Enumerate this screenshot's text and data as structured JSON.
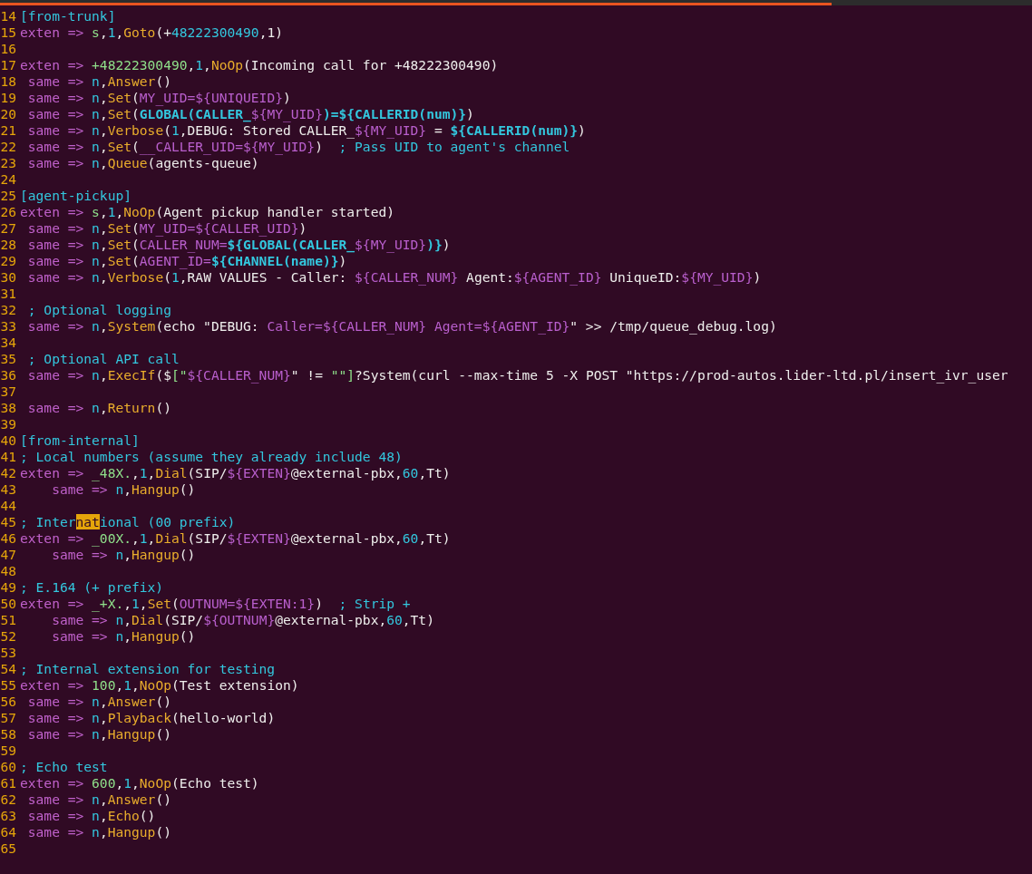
{
  "editor": {
    "lines": [
      {
        "number": "14",
        "segments": [
          {
            "kind": "section",
            "text": "[from-trunk]"
          }
        ]
      },
      {
        "number": "15",
        "segments": [
          {
            "kind": "keyword",
            "text": "exten => "
          },
          {
            "kind": "ext",
            "text": "s"
          },
          {
            "kind": "plain",
            "text": ","
          },
          {
            "kind": "number",
            "text": "1"
          },
          {
            "kind": "plain",
            "text": ","
          },
          {
            "kind": "function",
            "text": "Goto"
          },
          {
            "kind": "plain",
            "text": "(+"
          },
          {
            "kind": "number",
            "text": "48222300490"
          },
          {
            "kind": "plain",
            "text": ",1)"
          }
        ]
      },
      {
        "number": "16"
      },
      {
        "number": "17",
        "segments": [
          {
            "kind": "keyword",
            "text": "exten => "
          },
          {
            "kind": "ext",
            "text": "+48222300490"
          },
          {
            "kind": "plain",
            "text": ","
          },
          {
            "kind": "number",
            "text": "1"
          },
          {
            "kind": "plain",
            "text": ","
          },
          {
            "kind": "function",
            "text": "NoOp"
          },
          {
            "kind": "plain",
            "text": "(Incoming call for +48222300490)"
          }
        ]
      },
      {
        "number": "18",
        "segments": [
          {
            "kind": "keyword",
            "text": " same => "
          },
          {
            "kind": "number",
            "text": "n"
          },
          {
            "kind": "plain",
            "text": ","
          },
          {
            "kind": "function",
            "text": "Answer"
          },
          {
            "kind": "plain",
            "text": "()"
          }
        ]
      },
      {
        "number": "19",
        "segments": [
          {
            "kind": "keyword",
            "text": " same => "
          },
          {
            "kind": "number",
            "text": "n"
          },
          {
            "kind": "plain",
            "text": ","
          },
          {
            "kind": "function",
            "text": "Set"
          },
          {
            "kind": "plain",
            "text": "("
          },
          {
            "kind": "variable",
            "text": "MY_UID=${UNIQUEID}"
          },
          {
            "kind": "plain",
            "text": ")"
          }
        ]
      },
      {
        "number": "20",
        "segments": [
          {
            "kind": "keyword",
            "text": " same => "
          },
          {
            "kind": "number",
            "text": "n"
          },
          {
            "kind": "plain",
            "text": ","
          },
          {
            "kind": "function",
            "text": "Set"
          },
          {
            "kind": "plain",
            "text": "("
          },
          {
            "kind": "bold-variable",
            "text": "GLOBAL(CALLER_"
          },
          {
            "kind": "variable",
            "text": "${MY_UID}"
          },
          {
            "kind": "bold-variable",
            "text": ")=${CALLERID(num)}"
          },
          {
            "kind": "plain",
            "text": ")"
          }
        ]
      },
      {
        "number": "21",
        "segments": [
          {
            "kind": "keyword",
            "text": " same => "
          },
          {
            "kind": "number",
            "text": "n"
          },
          {
            "kind": "plain",
            "text": ","
          },
          {
            "kind": "function",
            "text": "Verbose"
          },
          {
            "kind": "plain",
            "text": "("
          },
          {
            "kind": "number",
            "text": "1"
          },
          {
            "kind": "plain",
            "text": ",DEBUG: Stored CALLER_"
          },
          {
            "kind": "variable",
            "text": "${MY_UID}"
          },
          {
            "kind": "plain",
            "text": " = "
          },
          {
            "kind": "bold-variable",
            "text": "${CALLERID(num)}"
          },
          {
            "kind": "plain",
            "text": ")"
          }
        ]
      },
      {
        "number": "22",
        "segments": [
          {
            "kind": "keyword",
            "text": " same => "
          },
          {
            "kind": "number",
            "text": "n"
          },
          {
            "kind": "plain",
            "text": ","
          },
          {
            "kind": "function",
            "text": "Set"
          },
          {
            "kind": "plain",
            "text": "("
          },
          {
            "kind": "variable",
            "text": "__CALLER_UID=${MY_UID}"
          },
          {
            "kind": "plain",
            "text": ")"
          },
          {
            "kind": "comment",
            "text": "  ; Pass UID to agent's channel"
          }
        ]
      },
      {
        "number": "23",
        "segments": [
          {
            "kind": "keyword",
            "text": " same => "
          },
          {
            "kind": "number",
            "text": "n"
          },
          {
            "kind": "plain",
            "text": ","
          },
          {
            "kind": "function",
            "text": "Queue"
          },
          {
            "kind": "plain",
            "text": "(agents-queue)"
          }
        ]
      },
      {
        "number": "24"
      },
      {
        "number": "25",
        "segments": [
          {
            "kind": "section",
            "text": "[agent-pickup]"
          }
        ]
      },
      {
        "number": "26",
        "segments": [
          {
            "kind": "keyword",
            "text": "exten => "
          },
          {
            "kind": "ext",
            "text": "s"
          },
          {
            "kind": "plain",
            "text": ","
          },
          {
            "kind": "number",
            "text": "1"
          },
          {
            "kind": "plain",
            "text": ","
          },
          {
            "kind": "function",
            "text": "NoOp"
          },
          {
            "kind": "plain",
            "text": "(Agent pickup handler started)"
          }
        ]
      },
      {
        "number": "27",
        "segments": [
          {
            "kind": "keyword",
            "text": " same => "
          },
          {
            "kind": "number",
            "text": "n"
          },
          {
            "kind": "plain",
            "text": ","
          },
          {
            "kind": "function",
            "text": "Set"
          },
          {
            "kind": "plain",
            "text": "("
          },
          {
            "kind": "variable",
            "text": "MY_UID=${CALLER_UID}"
          },
          {
            "kind": "plain",
            "text": ")"
          }
        ]
      },
      {
        "number": "28",
        "segments": [
          {
            "kind": "keyword",
            "text": " same => "
          },
          {
            "kind": "number",
            "text": "n"
          },
          {
            "kind": "plain",
            "text": ","
          },
          {
            "kind": "function",
            "text": "Set"
          },
          {
            "kind": "plain",
            "text": "("
          },
          {
            "kind": "variable",
            "text": "CALLER_NUM="
          },
          {
            "kind": "bold-variable",
            "text": "${GLOBAL(CALLER_"
          },
          {
            "kind": "variable",
            "text": "${MY_UID}"
          },
          {
            "kind": "bold-variable",
            "text": ")}"
          },
          {
            "kind": "plain",
            "text": ")"
          }
        ]
      },
      {
        "number": "29",
        "segments": [
          {
            "kind": "keyword",
            "text": " same => "
          },
          {
            "kind": "number",
            "text": "n"
          },
          {
            "kind": "plain",
            "text": ","
          },
          {
            "kind": "function",
            "text": "Set"
          },
          {
            "kind": "plain",
            "text": "("
          },
          {
            "kind": "variable",
            "text": "AGENT_ID="
          },
          {
            "kind": "bold-variable",
            "text": "${CHANNEL(name)}"
          },
          {
            "kind": "plain",
            "text": ")"
          }
        ]
      },
      {
        "number": "30",
        "segments": [
          {
            "kind": "keyword",
            "text": " same => "
          },
          {
            "kind": "number",
            "text": "n"
          },
          {
            "kind": "plain",
            "text": ","
          },
          {
            "kind": "function",
            "text": "Verbose"
          },
          {
            "kind": "plain",
            "text": "("
          },
          {
            "kind": "number",
            "text": "1"
          },
          {
            "kind": "plain",
            "text": ",RAW VALUES - Caller: "
          },
          {
            "kind": "variable",
            "text": "${CALLER_NUM}"
          },
          {
            "kind": "plain",
            "text": " Agent:"
          },
          {
            "kind": "variable",
            "text": "${AGENT_ID}"
          },
          {
            "kind": "plain",
            "text": " UniqueID:"
          },
          {
            "kind": "variable",
            "text": "${MY_UID}"
          },
          {
            "kind": "plain",
            "text": ")"
          }
        ]
      },
      {
        "number": "31"
      },
      {
        "number": "32",
        "segments": [
          {
            "kind": "comment",
            "text": " ; Optional logging"
          }
        ]
      },
      {
        "number": "33",
        "segments": [
          {
            "kind": "keyword",
            "text": " same => "
          },
          {
            "kind": "number",
            "text": "n"
          },
          {
            "kind": "plain",
            "text": ","
          },
          {
            "kind": "function",
            "text": "System"
          },
          {
            "kind": "plain",
            "text": "(echo \"DEBUG: "
          },
          {
            "kind": "variable",
            "text": "Caller=${CALLER_NUM} Agent=${AGENT_ID}"
          },
          {
            "kind": "plain",
            "text": "\" >> /tmp/queue_debug.log)"
          }
        ]
      },
      {
        "number": "34"
      },
      {
        "number": "35",
        "segments": [
          {
            "kind": "comment",
            "text": " ; Optional API call"
          }
        ]
      },
      {
        "number": "36",
        "segments": [
          {
            "kind": "keyword",
            "text": " same => "
          },
          {
            "kind": "number",
            "text": "n"
          },
          {
            "kind": "plain",
            "text": ","
          },
          {
            "kind": "function",
            "text": "ExecIf"
          },
          {
            "kind": "plain",
            "text": "($"
          },
          {
            "kind": "ext",
            "text": "[\""
          },
          {
            "kind": "variable",
            "text": "${CALLER_NUM}"
          },
          {
            "kind": "plain",
            "text": "\" != "
          },
          {
            "kind": "ext",
            "text": "\"\"]"
          },
          {
            "kind": "plain",
            "text": "?System(curl --max-time 5 -X POST \"https://prod-autos.lider-ltd.pl/insert_ivr_user"
          }
        ]
      },
      {
        "number": "37"
      },
      {
        "number": "38",
        "segments": [
          {
            "kind": "keyword",
            "text": " same => "
          },
          {
            "kind": "number",
            "text": "n"
          },
          {
            "kind": "plain",
            "text": ","
          },
          {
            "kind": "function",
            "text": "Return"
          },
          {
            "kind": "plain",
            "text": "()"
          }
        ]
      },
      {
        "number": "39"
      },
      {
        "number": "40",
        "segments": [
          {
            "kind": "section",
            "text": "[from-internal]"
          }
        ]
      },
      {
        "number": "41",
        "segments": [
          {
            "kind": "comment",
            "text": "; Local numbers (assume they already include 48)"
          }
        ]
      },
      {
        "number": "42",
        "segments": [
          {
            "kind": "keyword",
            "text": "exten => "
          },
          {
            "kind": "ext",
            "text": "_48X."
          },
          {
            "kind": "plain",
            "text": ","
          },
          {
            "kind": "number",
            "text": "1"
          },
          {
            "kind": "plain",
            "text": ","
          },
          {
            "kind": "function",
            "text": "Dial"
          },
          {
            "kind": "plain",
            "text": "(SIP/"
          },
          {
            "kind": "variable",
            "text": "${EXTEN}"
          },
          {
            "kind": "plain",
            "text": "@external-pbx,"
          },
          {
            "kind": "number",
            "text": "60"
          },
          {
            "kind": "plain",
            "text": ",Tt)"
          }
        ]
      },
      {
        "number": "43",
        "segments": [
          {
            "kind": "keyword",
            "text": "    same => "
          },
          {
            "kind": "number",
            "text": "n"
          },
          {
            "kind": "plain",
            "text": ","
          },
          {
            "kind": "function",
            "text": "Hangup"
          },
          {
            "kind": "plain",
            "text": "()"
          }
        ]
      },
      {
        "number": "44"
      },
      {
        "number": "45",
        "segments": [
          {
            "kind": "comment",
            "text": "; Inter"
          },
          {
            "kind": "search-match",
            "text": "nat"
          },
          {
            "kind": "comment",
            "text": "ional (00 prefix)"
          }
        ]
      },
      {
        "number": "46",
        "segments": [
          {
            "kind": "keyword",
            "text": "exten => "
          },
          {
            "kind": "ext",
            "text": "_00X."
          },
          {
            "kind": "plain",
            "text": ","
          },
          {
            "kind": "number",
            "text": "1"
          },
          {
            "kind": "plain",
            "text": ","
          },
          {
            "kind": "function",
            "text": "Dial"
          },
          {
            "kind": "plain",
            "text": "(SIP/"
          },
          {
            "kind": "variable",
            "text": "${EXTEN}"
          },
          {
            "kind": "plain",
            "text": "@external-pbx,"
          },
          {
            "kind": "number",
            "text": "60"
          },
          {
            "kind": "plain",
            "text": ",Tt)"
          }
        ]
      },
      {
        "number": "47",
        "segments": [
          {
            "kind": "keyword",
            "text": "    same => "
          },
          {
            "kind": "number",
            "text": "n"
          },
          {
            "kind": "plain",
            "text": ","
          },
          {
            "kind": "function",
            "text": "Hangup"
          },
          {
            "kind": "plain",
            "text": "()"
          }
        ]
      },
      {
        "number": "48"
      },
      {
        "number": "49",
        "segments": [
          {
            "kind": "comment",
            "text": "; E.164 (+ prefix)"
          }
        ]
      },
      {
        "number": "50",
        "segments": [
          {
            "kind": "keyword",
            "text": "exten => "
          },
          {
            "kind": "ext",
            "text": "_+X."
          },
          {
            "kind": "plain",
            "text": ","
          },
          {
            "kind": "number",
            "text": "1"
          },
          {
            "kind": "plain",
            "text": ","
          },
          {
            "kind": "function",
            "text": "Set"
          },
          {
            "kind": "plain",
            "text": "("
          },
          {
            "kind": "variable",
            "text": "OUTNUM=${EXTEN:1}"
          },
          {
            "kind": "plain",
            "text": ")"
          },
          {
            "kind": "comment",
            "text": "  ; Strip +"
          }
        ]
      },
      {
        "number": "51",
        "segments": [
          {
            "kind": "keyword",
            "text": "    same => "
          },
          {
            "kind": "number",
            "text": "n"
          },
          {
            "kind": "plain",
            "text": ","
          },
          {
            "kind": "function",
            "text": "Dial"
          },
          {
            "kind": "plain",
            "text": "(SIP/"
          },
          {
            "kind": "variable",
            "text": "${OUTNUM}"
          },
          {
            "kind": "plain",
            "text": "@external-pbx,"
          },
          {
            "kind": "number",
            "text": "60"
          },
          {
            "kind": "plain",
            "text": ",Tt)"
          }
        ]
      },
      {
        "number": "52",
        "segments": [
          {
            "kind": "keyword",
            "text": "    same => "
          },
          {
            "kind": "number",
            "text": "n"
          },
          {
            "kind": "plain",
            "text": ","
          },
          {
            "kind": "function",
            "text": "Hangup"
          },
          {
            "kind": "plain",
            "text": "()"
          }
        ]
      },
      {
        "number": "53"
      },
      {
        "number": "54",
        "segments": [
          {
            "kind": "comment",
            "text": "; Internal extension for testing"
          }
        ]
      },
      {
        "number": "55",
        "segments": [
          {
            "kind": "keyword",
            "text": "exten => "
          },
          {
            "kind": "ext",
            "text": "100"
          },
          {
            "kind": "plain",
            "text": ","
          },
          {
            "kind": "number",
            "text": "1"
          },
          {
            "kind": "plain",
            "text": ","
          },
          {
            "kind": "function",
            "text": "NoOp"
          },
          {
            "kind": "plain",
            "text": "(Test extension)"
          }
        ]
      },
      {
        "number": "56",
        "segments": [
          {
            "kind": "keyword",
            "text": " same => "
          },
          {
            "kind": "number",
            "text": "n"
          },
          {
            "kind": "plain",
            "text": ","
          },
          {
            "kind": "function",
            "text": "Answer"
          },
          {
            "kind": "plain",
            "text": "()"
          }
        ]
      },
      {
        "number": "57",
        "segments": [
          {
            "kind": "keyword",
            "text": " same => "
          },
          {
            "kind": "number",
            "text": "n"
          },
          {
            "kind": "plain",
            "text": ","
          },
          {
            "kind": "function",
            "text": "Playback"
          },
          {
            "kind": "plain",
            "text": "(hello-world)"
          }
        ]
      },
      {
        "number": "58",
        "segments": [
          {
            "kind": "keyword",
            "text": " same => "
          },
          {
            "kind": "number",
            "text": "n"
          },
          {
            "kind": "plain",
            "text": ","
          },
          {
            "kind": "function",
            "text": "Hangup"
          },
          {
            "kind": "plain",
            "text": "()"
          }
        ]
      },
      {
        "number": "59"
      },
      {
        "number": "60",
        "segments": [
          {
            "kind": "comment",
            "text": "; Echo test"
          }
        ]
      },
      {
        "number": "61",
        "segments": [
          {
            "kind": "keyword",
            "text": "exten => "
          },
          {
            "kind": "ext",
            "text": "600"
          },
          {
            "kind": "plain",
            "text": ","
          },
          {
            "kind": "number",
            "text": "1"
          },
          {
            "kind": "plain",
            "text": ","
          },
          {
            "kind": "function",
            "text": "NoOp"
          },
          {
            "kind": "plain",
            "text": "(Echo test)"
          }
        ]
      },
      {
        "number": "62",
        "segments": [
          {
            "kind": "keyword",
            "text": " same => "
          },
          {
            "kind": "number",
            "text": "n"
          },
          {
            "kind": "plain",
            "text": ","
          },
          {
            "kind": "function",
            "text": "Answer"
          },
          {
            "kind": "plain",
            "text": "()"
          }
        ]
      },
      {
        "number": "63",
        "segments": [
          {
            "kind": "keyword",
            "text": " same => "
          },
          {
            "kind": "number",
            "text": "n"
          },
          {
            "kind": "plain",
            "text": ","
          },
          {
            "kind": "function",
            "text": "Echo"
          },
          {
            "kind": "plain",
            "text": "()"
          }
        ]
      },
      {
        "number": "64",
        "segments": [
          {
            "kind": "keyword",
            "text": " same => "
          },
          {
            "kind": "number",
            "text": "n"
          },
          {
            "kind": "plain",
            "text": ","
          },
          {
            "kind": "function",
            "text": "Hangup"
          },
          {
            "kind": "plain",
            "text": "()"
          }
        ]
      },
      {
        "number": "65"
      }
    ]
  }
}
